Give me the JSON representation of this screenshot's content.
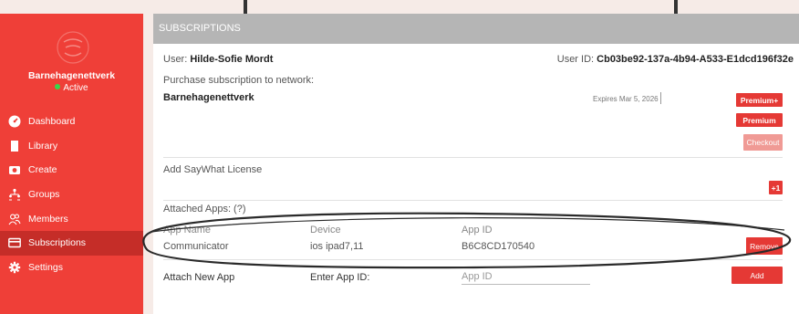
{
  "sidebar": {
    "org_name": "Barnehagenettverk",
    "org_status": "Active",
    "items": [
      {
        "label": "Dashboard",
        "icon": "dashboard-icon",
        "active": false
      },
      {
        "label": "Library",
        "icon": "library-icon",
        "active": false
      },
      {
        "label": "Create",
        "icon": "camera-icon",
        "active": false
      },
      {
        "label": "Groups",
        "icon": "groups-icon",
        "active": false
      },
      {
        "label": "Members",
        "icon": "members-icon",
        "active": false
      },
      {
        "label": "Subscriptions",
        "icon": "card-icon",
        "active": true
      },
      {
        "label": "Settings",
        "icon": "gear-icon",
        "active": false
      }
    ]
  },
  "panel": {
    "title": "SUBSCRIPTIONS",
    "user_label": "User:",
    "user_name": "Hilde-Sofie Mordt",
    "user_id_label": "User ID:",
    "user_id": "Cb03be92-137a-4b94-A533-E1dcd196f32e",
    "purchase_label": "Purchase subscription to network:",
    "network_name": "Barnehagenettverk",
    "expires": "Expires Mar 5, 2026",
    "premium_plus": "Premium+",
    "premium": "Premium",
    "checkout": "Checkout",
    "saywhat_label": "Add SayWhat License",
    "plus_one": "+1",
    "attached_label": "Attached Apps: (?)",
    "apps_columns": [
      "App Name",
      "Device",
      "App ID"
    ],
    "apps_rows": [
      {
        "name": "Communicator",
        "device": "ios ipad7,11",
        "app_id": "B6C8CD170540",
        "action": "Remove"
      }
    ],
    "attach_new_label": "Attach New App",
    "enter_app_id_label": "Enter App ID:",
    "app_id_placeholder": "App ID",
    "add_label": "Add"
  },
  "colors": {
    "sidebar": "#ef3f38",
    "sidebar_active": "#c52d28",
    "header": "#b5b5b5",
    "button": "#e53935",
    "background": "#f6ebe7"
  }
}
